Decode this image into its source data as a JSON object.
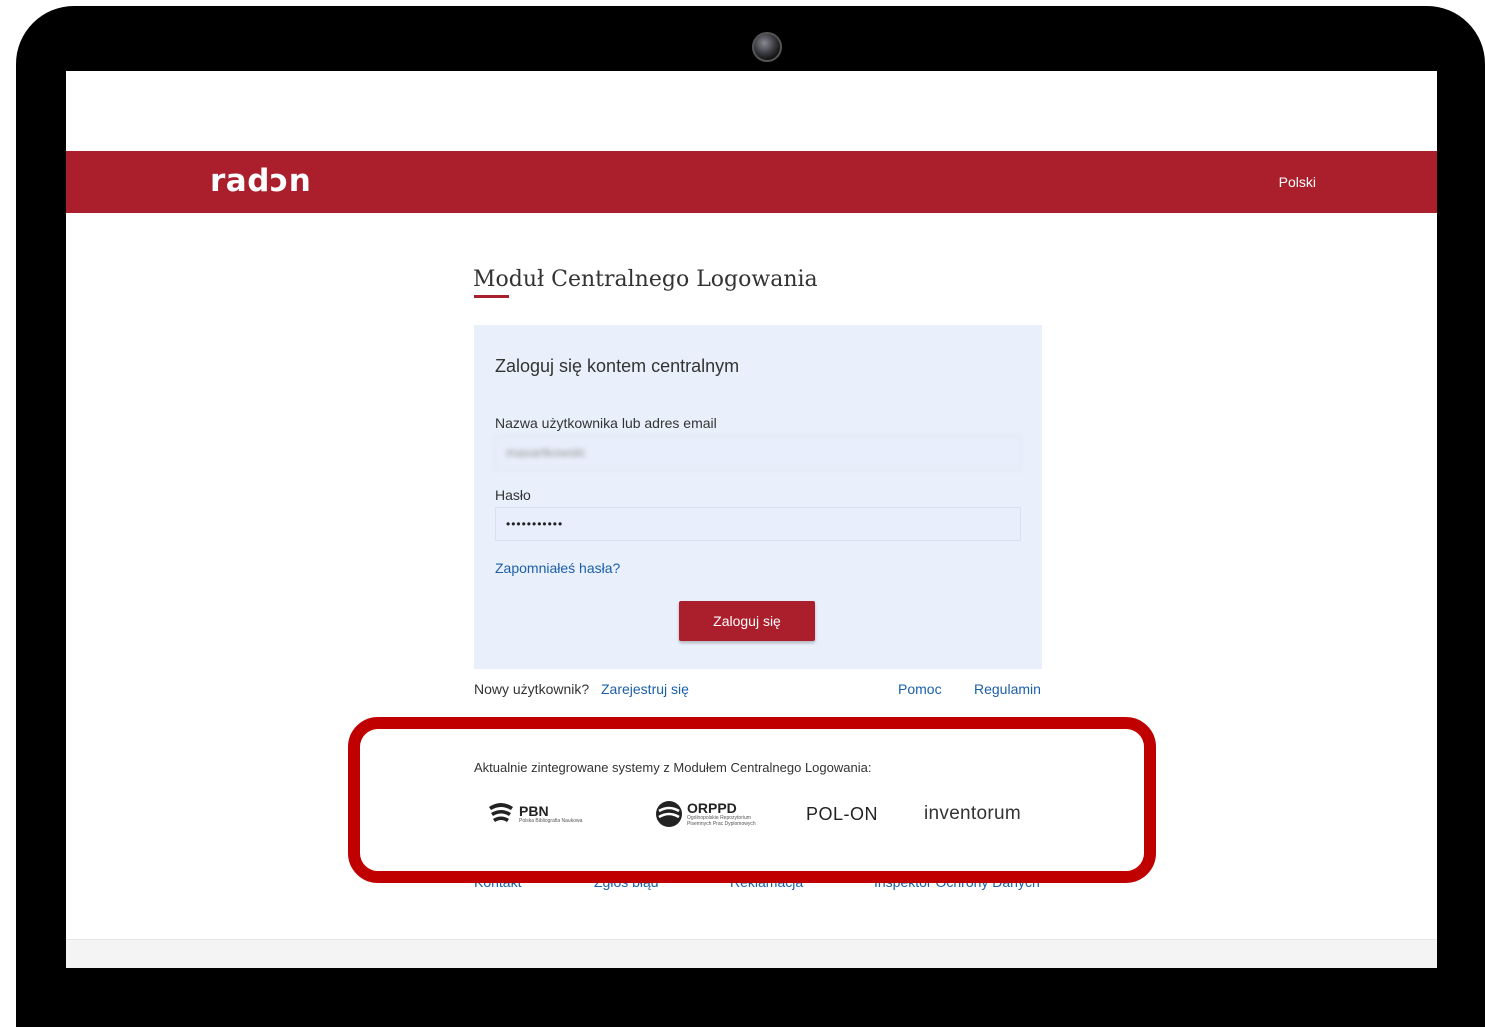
{
  "header": {
    "logo": "radɔn",
    "language": "Polski"
  },
  "page": {
    "title": "Moduł Centralnego Logowania"
  },
  "login": {
    "heading": "Zaloguj się kontem centralnym",
    "username_label": "Nazwa użytkownika lub adres email",
    "username_value": "maxartkowski",
    "password_label": "Hasło",
    "password_value": "•••••••••••",
    "forgot_link": "Zapomniałeś hasła?",
    "submit_label": "Zaloguj się"
  },
  "links": {
    "new_user": "Nowy użytkownik?",
    "register": "Zarejestruj się",
    "help": "Pomoc",
    "terms": "Regulamin"
  },
  "integrated": {
    "text": "Aktualnie zintegrowane systemy z Modułem Centralnego Logowania:",
    "systems": [
      {
        "name": "PBN",
        "subtitle": "Polska Bibliografia Naukowa"
      },
      {
        "name": "ORPPD",
        "subtitle": "Ogólnopolskie Repozytorium Pisemnych Prac Dyplomowych"
      },
      {
        "name": "POL-ON",
        "subtitle": ""
      },
      {
        "name": "inventorum",
        "subtitle": ""
      }
    ]
  },
  "footer": {
    "links": [
      "Kontakt",
      "Zgłoś błąd",
      "Reklamacja",
      "Inspektor Ochrony Danych"
    ]
  },
  "colors": {
    "brand": "#ab1f2c",
    "link": "#1b5fa8",
    "box": "#e9f0fb",
    "highlight": "#c00000"
  }
}
